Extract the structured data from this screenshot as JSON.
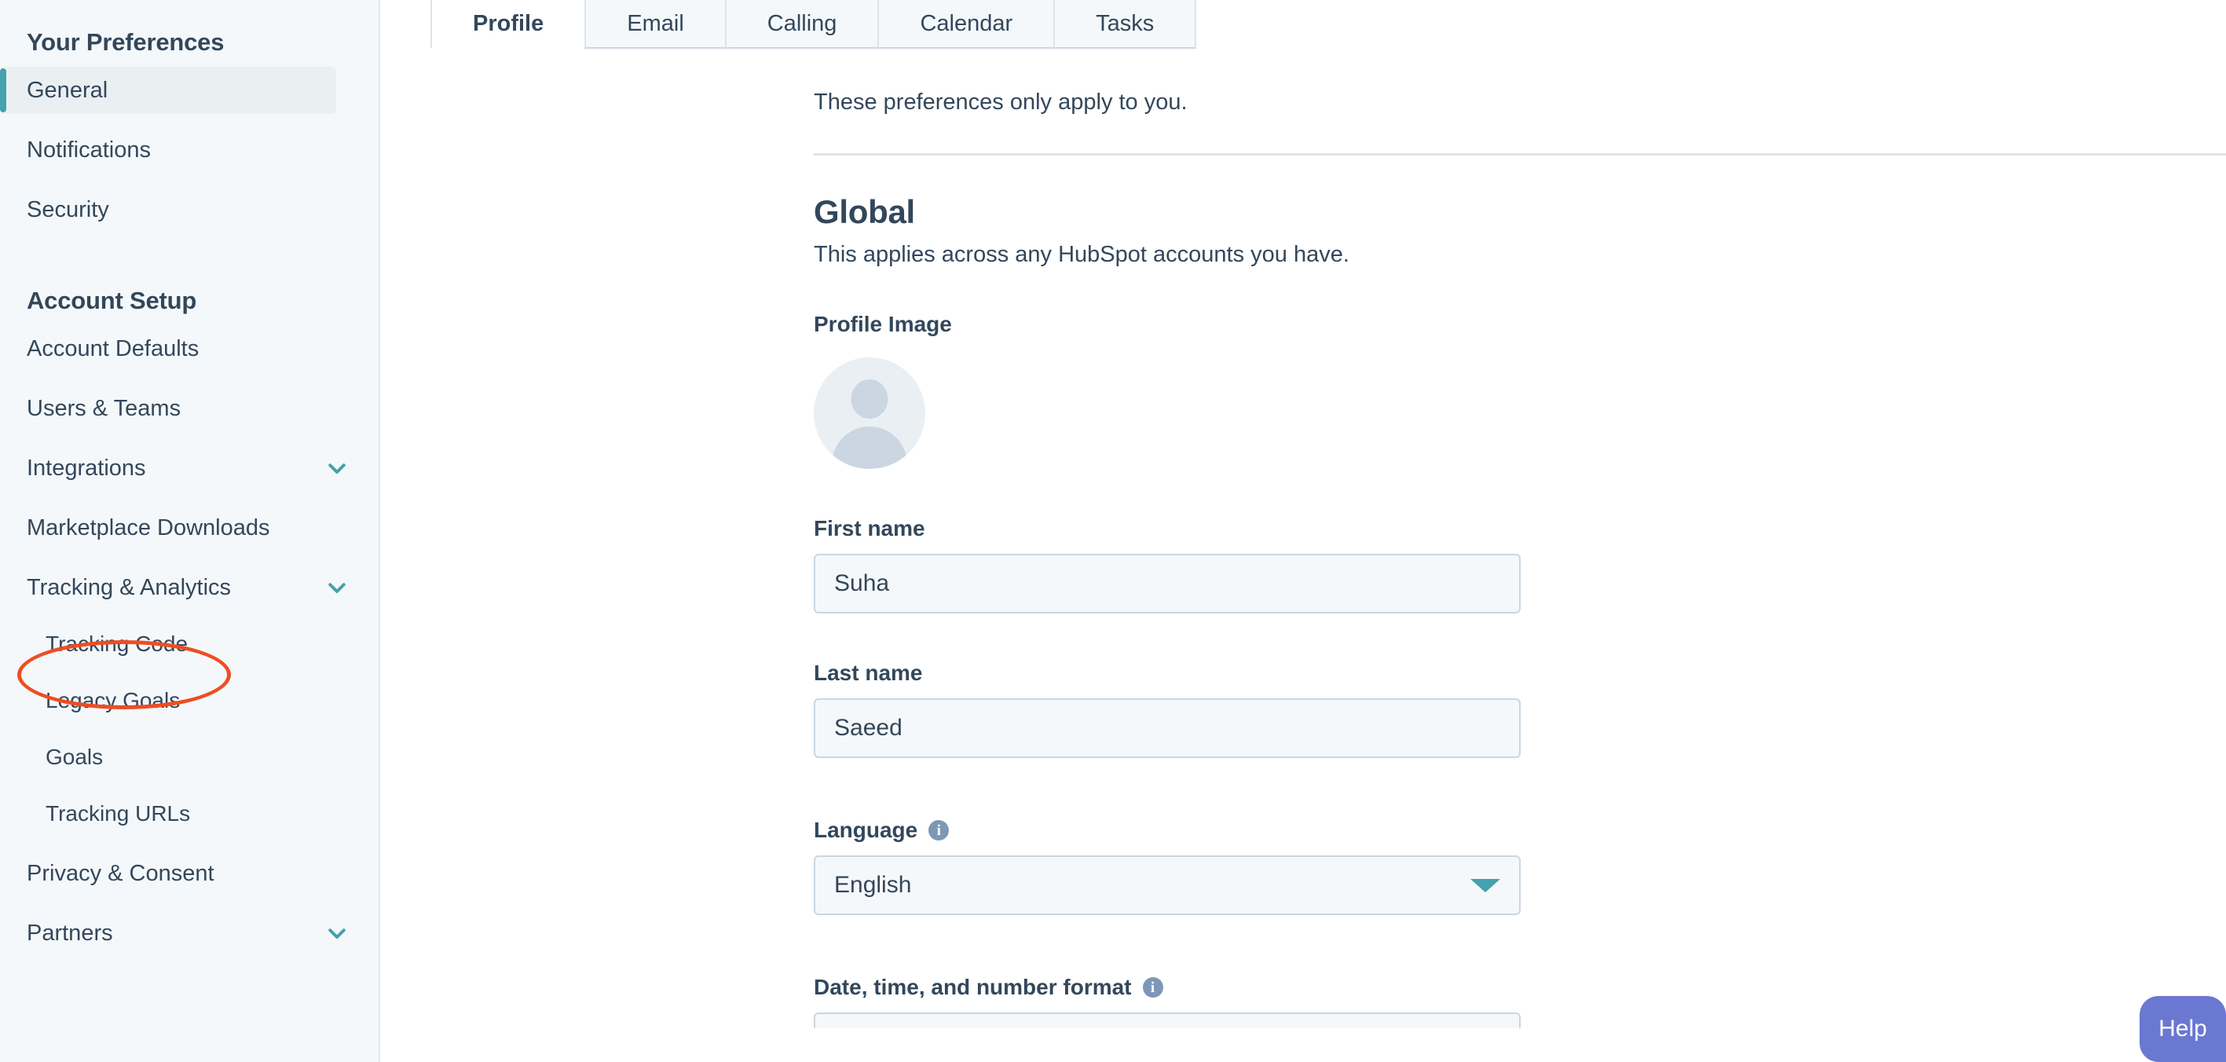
{
  "sidebar": {
    "sections": [
      {
        "heading": "Your Preferences",
        "items": [
          {
            "label": "General",
            "active": true,
            "sub": false,
            "chevron": false
          },
          {
            "label": "Notifications",
            "active": false,
            "sub": false,
            "chevron": false
          },
          {
            "label": "Security",
            "active": false,
            "sub": false,
            "chevron": false
          }
        ]
      },
      {
        "heading": "Account Setup",
        "items": [
          {
            "label": "Account Defaults",
            "active": false,
            "sub": false,
            "chevron": false
          },
          {
            "label": "Users & Teams",
            "active": false,
            "sub": false,
            "chevron": false
          },
          {
            "label": "Integrations",
            "active": false,
            "sub": false,
            "chevron": true
          },
          {
            "label": "Marketplace Downloads",
            "active": false,
            "sub": false,
            "chevron": false
          },
          {
            "label": "Tracking & Analytics",
            "active": false,
            "sub": false,
            "chevron": true
          },
          {
            "label": "Tracking Code",
            "active": false,
            "sub": true,
            "chevron": false
          },
          {
            "label": "Legacy Goals",
            "active": false,
            "sub": true,
            "chevron": false
          },
          {
            "label": "Goals",
            "active": false,
            "sub": true,
            "chevron": false
          },
          {
            "label": "Tracking URLs",
            "active": false,
            "sub": true,
            "chevron": false
          },
          {
            "label": "Privacy & Consent",
            "active": false,
            "sub": false,
            "chevron": false
          },
          {
            "label": "Partners",
            "active": false,
            "sub": false,
            "chevron": true
          }
        ]
      }
    ]
  },
  "annotation": {
    "target_label": "Tracking Code",
    "color": "#ef4d22",
    "shape": "ellipse"
  },
  "tabs": [
    {
      "label": "Profile",
      "active": true
    },
    {
      "label": "Email",
      "active": false
    },
    {
      "label": "Calling",
      "active": false
    },
    {
      "label": "Calendar",
      "active": false
    },
    {
      "label": "Tasks",
      "active": false
    }
  ],
  "main": {
    "subtitle": "These preferences only apply to you.",
    "section_title": "Global",
    "section_desc": "This applies across any HubSpot accounts you have.",
    "profile_image_label": "Profile Image",
    "first_name": {
      "label": "First name",
      "value": "Suha"
    },
    "last_name": {
      "label": "Last name",
      "value": "Saeed"
    },
    "language": {
      "label": "Language",
      "value": "English",
      "has_info": true
    },
    "date_format": {
      "label": "Date, time, and number format",
      "has_info": true
    }
  },
  "help": {
    "label": "Help"
  },
  "colors": {
    "accent_teal": "#45a1ad",
    "text": "#33475b",
    "sidebar_bg": "#f5f8fa",
    "annotation_red": "#ef4d22",
    "help_purple": "#6a78d1"
  }
}
